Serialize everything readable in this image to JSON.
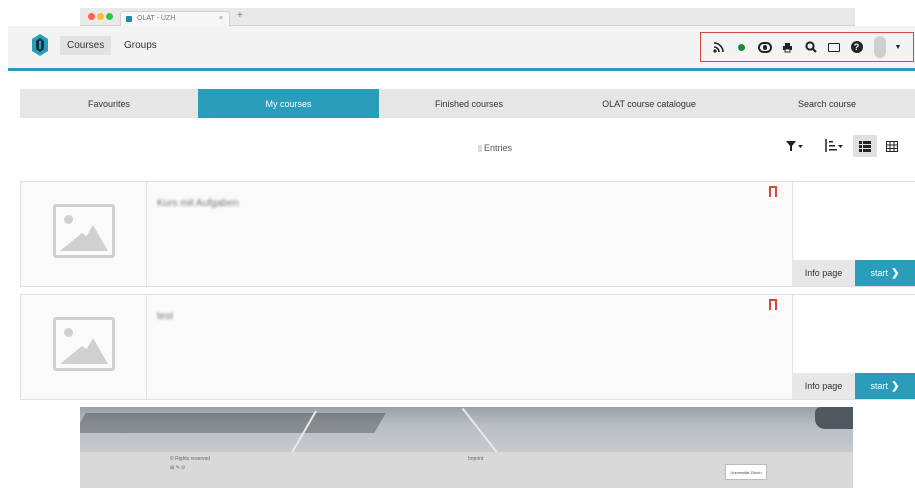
{
  "browser": {
    "tab_title": "OLAT - UZH",
    "tab_close": "×",
    "new_tab": "+"
  },
  "nav": {
    "courses": "Courses",
    "groups": "Groups"
  },
  "toolbox": {
    "rss": "rss-icon",
    "status": "online-status-icon",
    "chat": "chat-icon",
    "print": "print-icon",
    "search": "search-icon",
    "mail": "mail-icon",
    "help": "help-icon",
    "avatar": "user-avatar",
    "caret": "caret-down-icon"
  },
  "tabs": [
    {
      "label": "Favourites",
      "active": false
    },
    {
      "label": "My courses",
      "active": true
    },
    {
      "label": "Finished courses",
      "active": false
    },
    {
      "label": "OLAT course catalogue",
      "active": false
    },
    {
      "label": "Search course",
      "active": false
    }
  ],
  "entries_label": "Entries",
  "courses": [
    {
      "title": "Kurs mit Aufgaben",
      "info": "Info page",
      "start": "start"
    },
    {
      "title": "test",
      "info": "Info page",
      "start": "start"
    }
  ],
  "footer": {
    "left1": "© Rights reserved",
    "left2": "⊞ ✎ ⊙",
    "center": "Imprint",
    "logo": "Universität Zürich"
  },
  "colors": {
    "accent": "#2a9dbb",
    "highlight_border": "#d6473f",
    "bookmark": "#d6473f"
  }
}
